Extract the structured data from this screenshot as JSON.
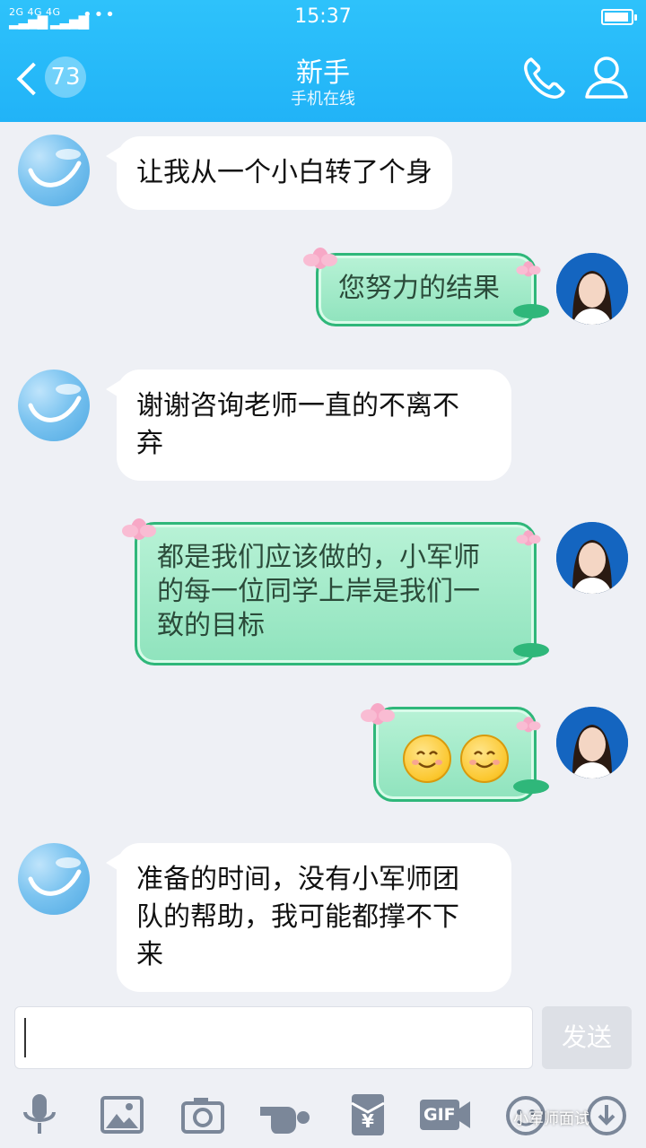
{
  "status_bar": {
    "network_top": "2G 4G 4G",
    "time": "15:37",
    "battery_level": 0.85
  },
  "header": {
    "unread_count": "73",
    "contact_name": "新手",
    "contact_status": "手机在线"
  },
  "messages": [
    {
      "side": "in",
      "text": "让我从一个小白转了个身"
    },
    {
      "side": "out",
      "text": "您努力的结果"
    },
    {
      "side": "in",
      "text": "谢谢咨询老师一直的不离不弃"
    },
    {
      "side": "out",
      "text": "都是我们应该做的，小军师的每一位同学上岸是我们一致的目标"
    },
    {
      "side": "out",
      "text": "",
      "emoji": [
        "smile-emoji",
        "smile-emoji"
      ]
    },
    {
      "side": "in",
      "text": "准备的时间，没有小军师团队的帮助，我可能都撑不下来"
    }
  ],
  "lines": {
    "m3": [
      "谢谢咨询老师一直的不离不",
      "弃"
    ],
    "m4": [
      "都是我们应该做的，小军师",
      "的每一位同学上岸是我们一",
      "致的目标"
    ],
    "m6": [
      "准备的时间，没有小军师团",
      "队的帮助，我可能都撑不下",
      "来"
    ]
  },
  "input": {
    "value": "",
    "send_label": "发送"
  },
  "toolbar": {
    "icons": [
      "microphone-icon",
      "image-icon",
      "camera-icon",
      "poke-icon",
      "red-packet-icon",
      "gif-icon",
      "emoji-icon",
      "more-icon"
    ],
    "gif_label": "GIF",
    "red_packet_label": "¥"
  },
  "watermark": "小军师面试",
  "colors": {
    "header": "#21b3f7",
    "bubble_out": "#8fe3bd",
    "bubble_out_border": "#2fb77a",
    "background": "#eef0f5"
  }
}
